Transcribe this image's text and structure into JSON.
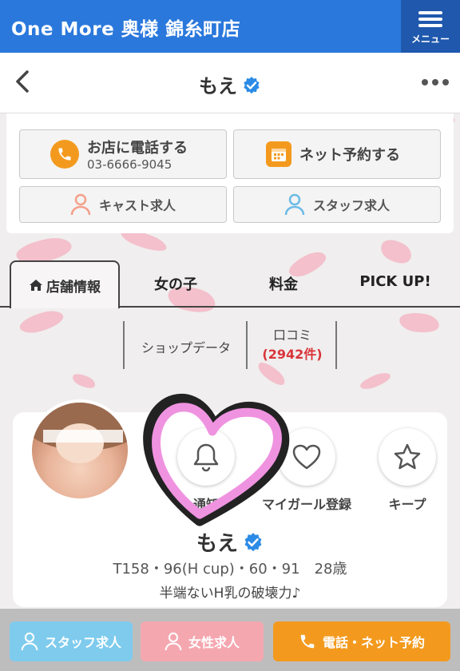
{
  "header": {
    "title": "One More 奥様 錦糸町店",
    "menu_label": "メニュー"
  },
  "navbar": {
    "title": "もえ"
  },
  "actions": {
    "call_label": "お店に電話する",
    "call_number": "03-6666-9045",
    "reserve_label": "ネット予約する",
    "cast_recruit": "キャスト求人",
    "staff_recruit": "スタッフ求人"
  },
  "tabs": [
    {
      "label": "店舗情報",
      "active": true
    },
    {
      "label": "女の子"
    },
    {
      "label": "料金"
    },
    {
      "label": "PICK UP!"
    }
  ],
  "subtabs": {
    "shop_data": "ショップデータ",
    "reviews": "口コミ",
    "reviews_count": "(2942件)"
  },
  "profile": {
    "name": "もえ",
    "stats": "T158・96(H cup)・60・91　28歳",
    "catchphrase": "半端ないH乳の破壊力♪",
    "actions": {
      "notify": "通知",
      "my_girl": "マイガール登録",
      "keep": "キープ"
    }
  },
  "bottom": {
    "staff": "スタッフ求人",
    "female": "女性求人",
    "call_reserve": "電話・ネット予約"
  },
  "colors": {
    "header": "#2a78dc",
    "menu": "#1f58ad",
    "orange": "#f39a1e",
    "light_blue": "#7ecbed",
    "pink": "#f5a7b0",
    "verified": "#2b8be6",
    "review_count": "#d9343a"
  }
}
